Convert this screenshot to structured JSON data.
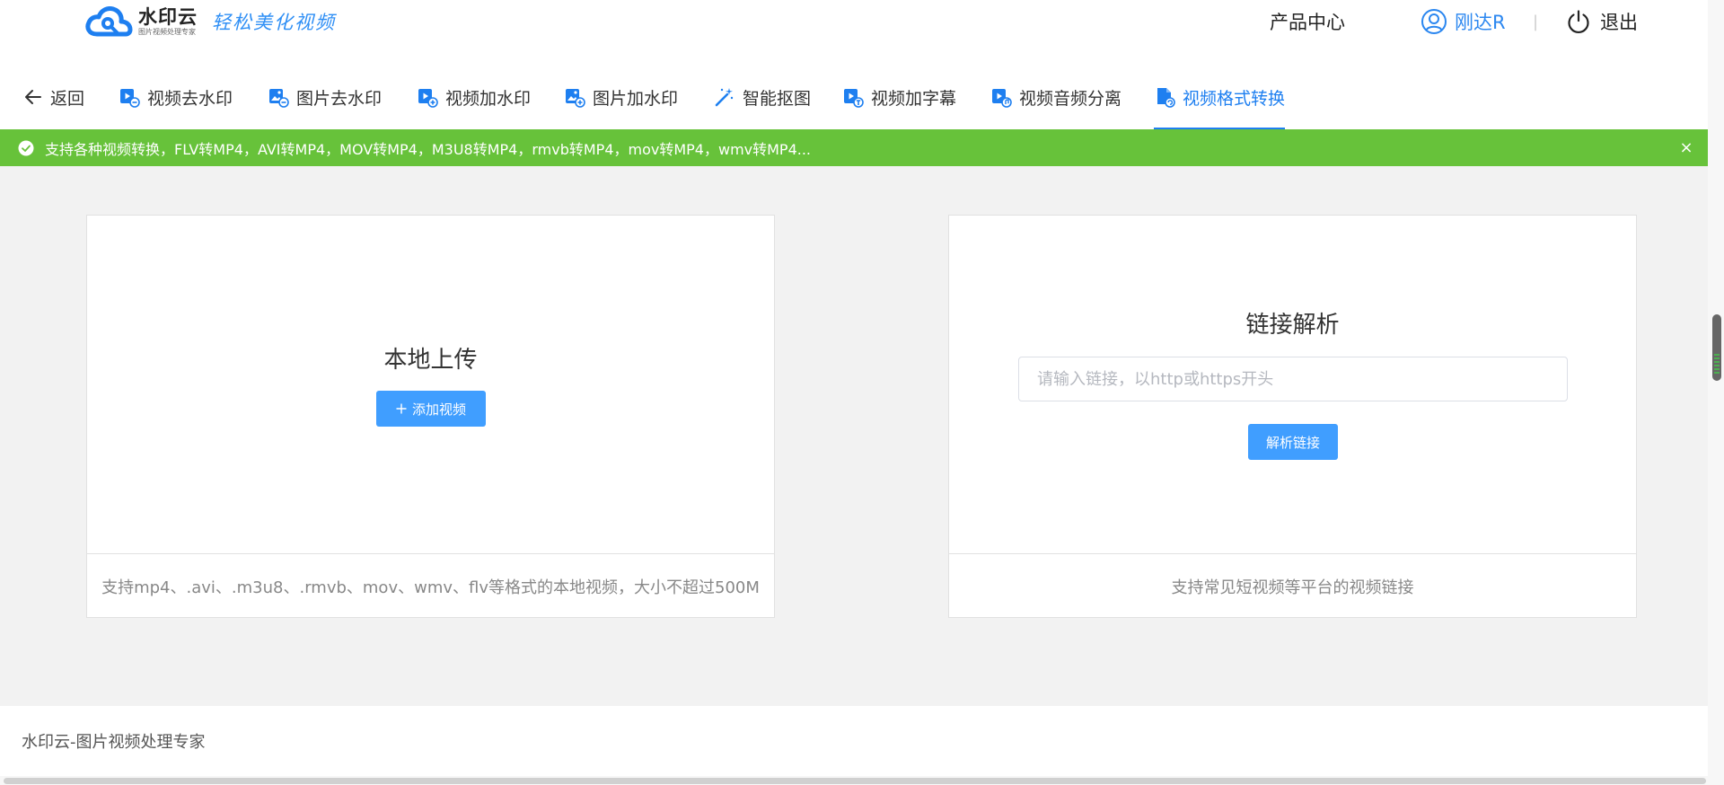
{
  "header": {
    "logo_name": "水印云",
    "logo_sub": "图片视频处理专家",
    "slogan": "轻松美化视频",
    "product_center": "产品中心",
    "user_name": "刚达R",
    "separator": "|",
    "logout": "退出"
  },
  "tabs": [
    {
      "label": "返回",
      "icon": "arrow-left-icon"
    },
    {
      "label": "视频去水印",
      "icon": "video-remove-icon"
    },
    {
      "label": "图片去水印",
      "icon": "image-remove-icon"
    },
    {
      "label": "视频加水印",
      "icon": "video-add-icon"
    },
    {
      "label": "图片加水印",
      "icon": "image-add-icon"
    },
    {
      "label": "智能抠图",
      "icon": "magic-wand-icon"
    },
    {
      "label": "视频加字幕",
      "icon": "video-subtitle-icon"
    },
    {
      "label": "视频音频分离",
      "icon": "video-audio-icon"
    },
    {
      "label": "视频格式转换",
      "icon": "mp4-file-icon",
      "active": true
    }
  ],
  "notice": {
    "text": "支持各种视频转换，FLV转MP4，AVI转MP4，MOV转MP4，M3U8转MP4，rmvb转MP4，mov转MP4，wmv转MP4...",
    "close": "×"
  },
  "local_upload": {
    "title": "本地上传",
    "button": "添加视频",
    "footer": "支持mp4、.avi、.m3u8、.rmvb、mov、wmv、flv等格式的本地视频，大小不超过500M"
  },
  "link_parse": {
    "title": "链接解析",
    "placeholder": "请输入链接，以http或https开头",
    "value": "",
    "button": "解析链接",
    "footer": "支持常见短视频等平台的视频链接"
  },
  "footer": {
    "text": "水印云-图片视频处理专家"
  },
  "colors": {
    "accent": "#1e7ff0",
    "button": "#409eff",
    "notice_bg": "#67c23a"
  }
}
